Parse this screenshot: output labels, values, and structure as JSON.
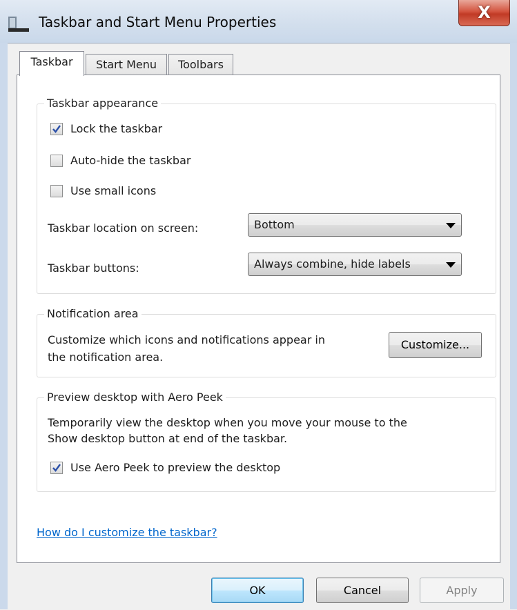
{
  "window": {
    "title": "Taskbar and Start Menu Properties",
    "close_label": "X"
  },
  "tabs": [
    {
      "label": "Taskbar"
    },
    {
      "label": "Start Menu"
    },
    {
      "label": "Toolbars"
    }
  ],
  "taskbar_appearance": {
    "legend": "Taskbar appearance",
    "lock": {
      "label": "Lock the taskbar",
      "checked": true
    },
    "autohide": {
      "label": "Auto-hide the taskbar",
      "checked": false
    },
    "small_icons": {
      "label": "Use small icons",
      "checked": false
    },
    "location": {
      "label": "Taskbar location on screen:",
      "value": "Bottom"
    },
    "buttons": {
      "label": "Taskbar buttons:",
      "value": "Always combine, hide labels"
    }
  },
  "notification_area": {
    "legend": "Notification area",
    "description_line1": "Customize which icons and notifications appear in",
    "description_line2": "the notification area.",
    "customize_label": "Customize..."
  },
  "aero_peek": {
    "legend": "Preview desktop with Aero Peek",
    "description_line1": "Temporarily view the desktop when you move your mouse to the",
    "description_line2": "Show desktop button at end of the taskbar.",
    "checkbox": {
      "label": "Use Aero Peek to preview the desktop",
      "checked": true
    }
  },
  "help_link": "How do I customize the taskbar?",
  "footer": {
    "ok": "OK",
    "cancel": "Cancel",
    "apply": "Apply"
  }
}
